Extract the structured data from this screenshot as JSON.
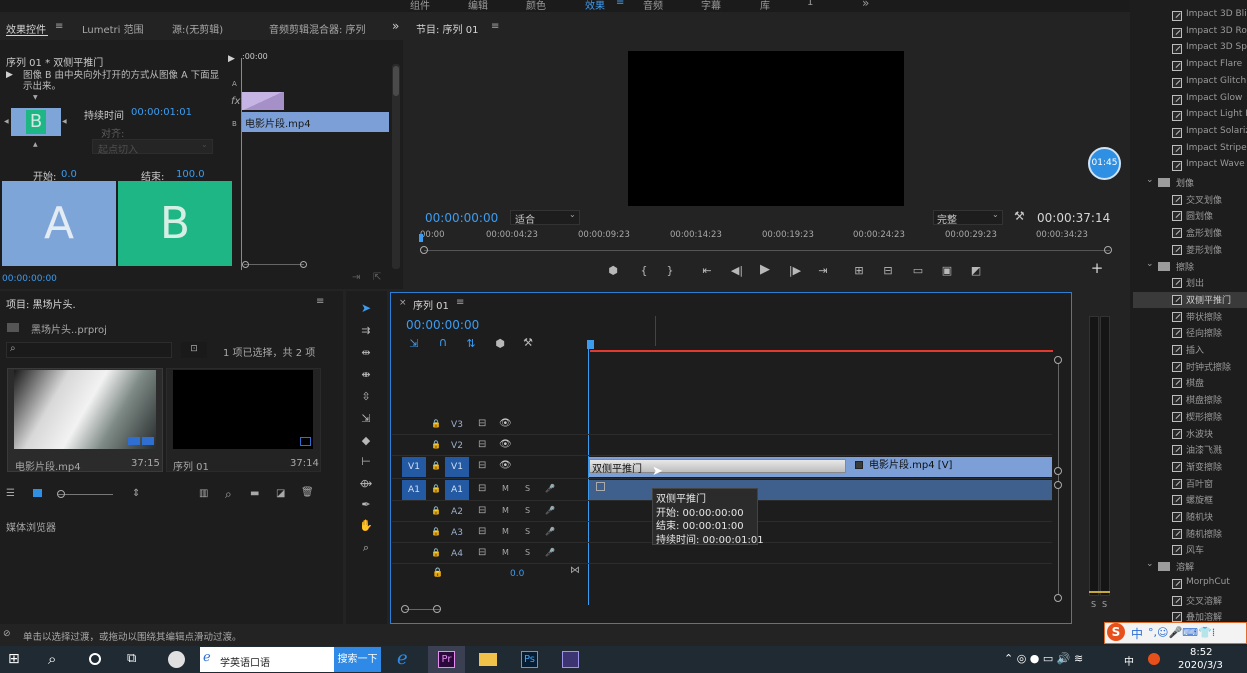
{
  "workspaces": [
    "组件",
    "编辑",
    "颜色",
    "效果",
    "音频",
    "字幕",
    "库",
    "1"
  ],
  "active_workspace": "效果",
  "more_glyph": "»",
  "effect_controls": {
    "tabs": [
      "效果控件",
      "Lumetri 范围",
      "源:(无剪辑)",
      "音频剪辑混合器: 序列"
    ],
    "title": "序列 01 * 双侧平推门",
    "description": "图像 B 由中央向外打开的方式从图像 A 下面显示出来。",
    "thumb_letter": "B",
    "duration_label": "持续时间",
    "duration_value": "00:00:01:01",
    "align_label": "对齐:",
    "align_value": "起点切入",
    "start_label": "开始:",
    "start_value": "0.0",
    "end_label": "结束:",
    "end_value": "100.0",
    "preview_a": "A",
    "preview_b": "B",
    "timecode": "00:00:00:00",
    "mini_ruler": ":00:00",
    "mini_track_a": "A",
    "mini_track_b": "B",
    "fx_glyph": "fx",
    "mini_clip": "电影片段.mp4"
  },
  "program_monitor": {
    "title": "节目: 序列 01",
    "timecode": "00:00:00:00",
    "zoom": "适合",
    "quality": "完整",
    "duration": "00:00:37:14",
    "ruler": [
      "00:00",
      "00:00:04:23",
      "00:00:09:23",
      "00:00:14:23",
      "00:00:19:23",
      "00:00:24:23",
      "00:00:29:23",
      "00:00:34:23"
    ],
    "badge": "01:45",
    "add_glyph": "+"
  },
  "project": {
    "title": "项目: 黑场片头.",
    "file": "黑场片头..prproj",
    "selection": "1 项已选择，共 2 项",
    "items": [
      {
        "name": "电影片段.mp4",
        "duration": "37:15"
      },
      {
        "name": "序列 01",
        "duration": "37:14"
      }
    ],
    "media_browser": "媒体浏览器"
  },
  "timeline": {
    "tab": "序列 01",
    "timecode": "00:00:00:00",
    "tracks": [
      {
        "name": "V3",
        "src": "",
        "m": "",
        "s": ""
      },
      {
        "name": "V2",
        "src": "",
        "m": "",
        "s": ""
      },
      {
        "name": "V1",
        "src": "V1",
        "m": "",
        "s": ""
      },
      {
        "name": "A1",
        "src": "A1",
        "m": "M",
        "s": "S"
      },
      {
        "name": "A2",
        "src": "",
        "m": "M",
        "s": "S"
      },
      {
        "name": "A3",
        "src": "",
        "m": "M",
        "s": "S"
      },
      {
        "name": "A4",
        "src": "",
        "m": "M",
        "s": "S"
      }
    ],
    "master_value": "0.0",
    "transition_label": "双侧平推门",
    "clip_label": "电影片段.mp4 [V]",
    "tooltip": {
      "name": "双侧平推门",
      "start": "开始: 00:00:00:00",
      "end": "结束: 00:00:01:00",
      "duration": "持续时间: 00:00:01:01"
    }
  },
  "effects": {
    "impact_items": [
      "Impact 3D Blinds",
      "Impact 3D Roll",
      "Impact 3D Spin",
      "Impact Flare",
      "Impact Glitch",
      "Impact Glow",
      "Impact Light Leaks",
      "Impact Solarize",
      "Impact Stripes",
      "Impact Wave"
    ],
    "folders": [
      {
        "name": "划像",
        "items": [
          "交叉划像",
          "圆划像",
          "盒形划像",
          "菱形划像"
        ]
      },
      {
        "name": "擦除",
        "items": [
          "划出",
          "双侧平推门",
          "带状擦除",
          "径向擦除",
          "插入",
          "时钟式擦除",
          "棋盘",
          "棋盘擦除",
          "楔形擦除",
          "水波块",
          "油漆飞溅",
          "渐变擦除",
          "百叶窗",
          "螺旋框",
          "随机块",
          "随机擦除",
          "风车"
        ]
      },
      {
        "name": "溶解",
        "items": [
          "MorphCut",
          "交叉溶解",
          "叠加溶解"
        ]
      }
    ],
    "selected": "双侧平推门",
    "meter_s": "S"
  },
  "status_text": "单击以选择过渡，或拖动以围绕其编辑点滑动过渡。",
  "taskbar": {
    "search_text": "学英语口语",
    "search_button": "搜索一下",
    "time": "8:52",
    "date": "2020/3/3",
    "ime": "中",
    "pr": "Pr",
    "ps": "Ps"
  },
  "colors": {
    "accent": "#2d8ceb",
    "clip": "#7b9fd6",
    "track_active": "#245aa3"
  }
}
